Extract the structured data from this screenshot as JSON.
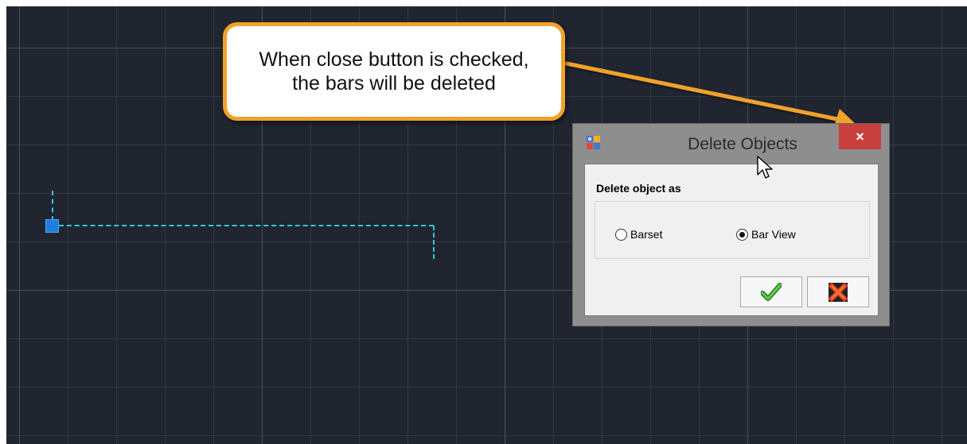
{
  "callout": {
    "text": "When close button is checked, the bars will be deleted"
  },
  "dialog": {
    "title": "Delete Objects",
    "close_glyph": "×",
    "group_label": "Delete object as",
    "options": [
      {
        "label": "Barset",
        "selected": false
      },
      {
        "label": "Bar View",
        "selected": true
      }
    ],
    "ok_icon": "checkmark-icon",
    "cancel_icon": "cross-icon"
  },
  "colors": {
    "canvas_bg": "#212530",
    "callout_border": "#f0a22b",
    "close_button": "#c7403d",
    "dashed_line": "#33c7d6",
    "grip": "#1e7fe0"
  }
}
